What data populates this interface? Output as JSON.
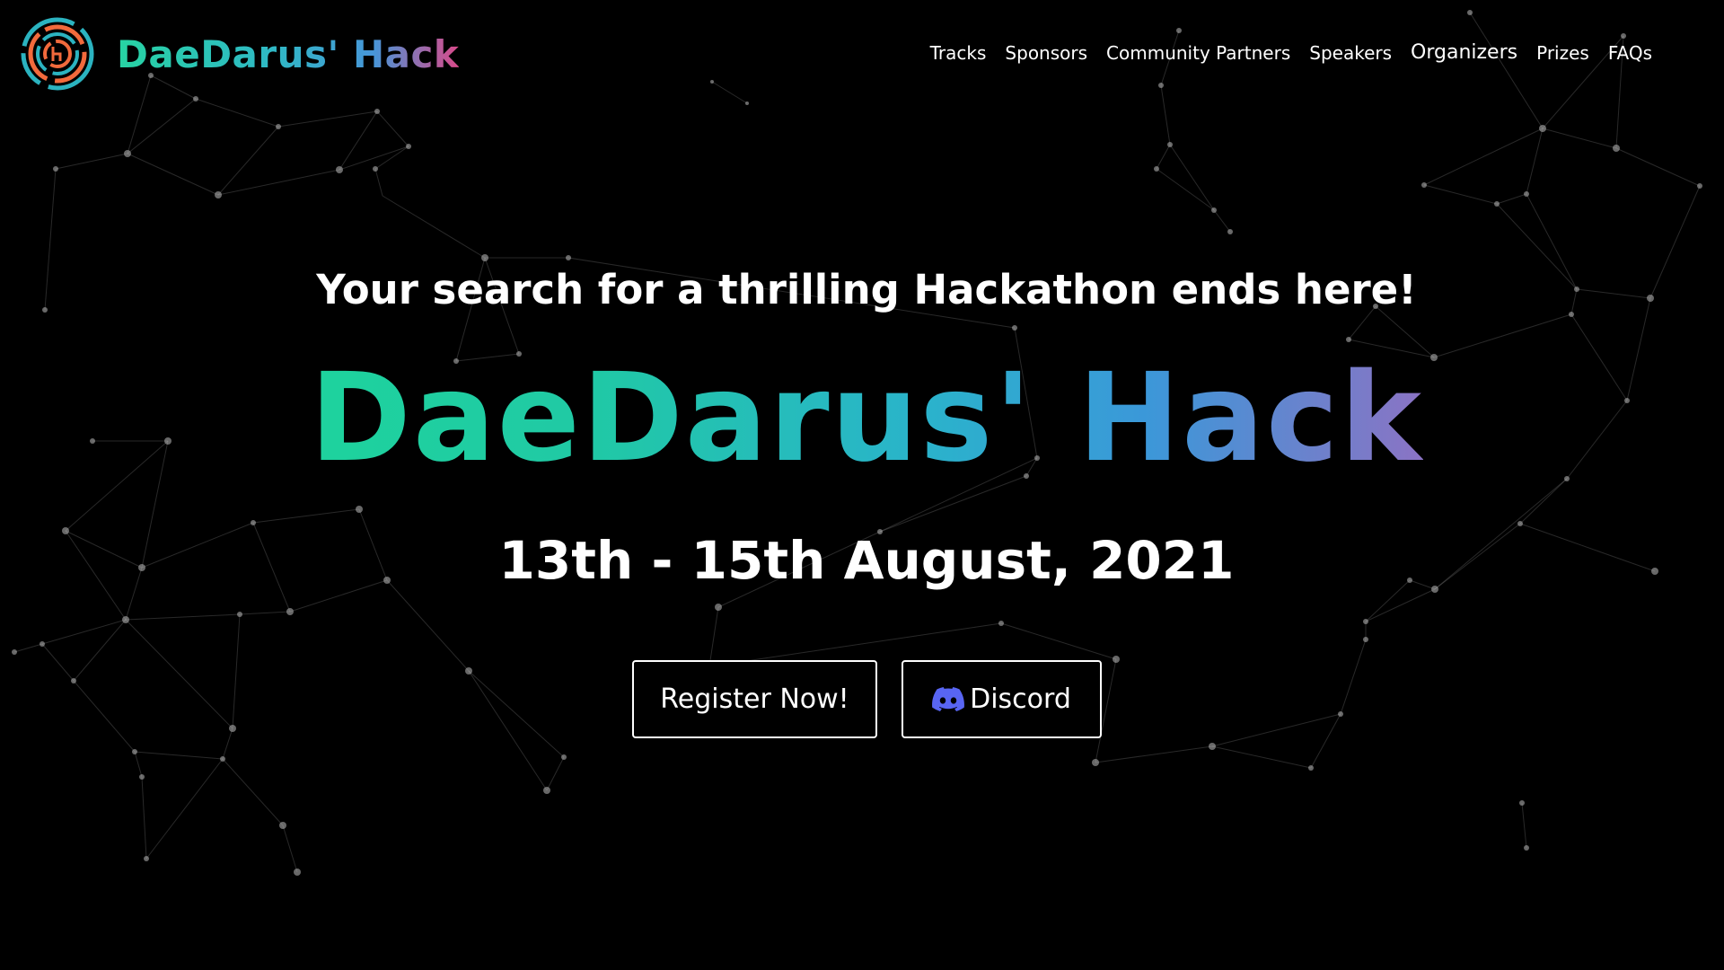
{
  "header": {
    "brand_name": "DaeDarus' Hack",
    "nav": [
      {
        "label": "Tracks"
      },
      {
        "label": "Sponsors"
      },
      {
        "label": "Community Partners"
      },
      {
        "label": "Speakers"
      },
      {
        "label": "Organizers"
      },
      {
        "label": "Prizes"
      },
      {
        "label": "FAQs"
      }
    ]
  },
  "hero": {
    "tagline": "Your search for a thrilling Hackathon ends here!",
    "title": "DaeDarus' Hack",
    "date": "13th - 15th August, 2021",
    "register_label": "Register Now!",
    "discord_label": "Discord"
  },
  "icons": {
    "logo": "maze-ring-logo-icon",
    "discord": "discord-icon"
  },
  "colors": {
    "background": "#000000",
    "gradient_start": "#1ed39d",
    "gradient_mid": "#2ab3cb",
    "gradient_end": "#8b73c4",
    "discord_blue": "#5865F2",
    "logo_orange": "#f26a3c",
    "logo_teal": "#2bb3c0"
  }
}
